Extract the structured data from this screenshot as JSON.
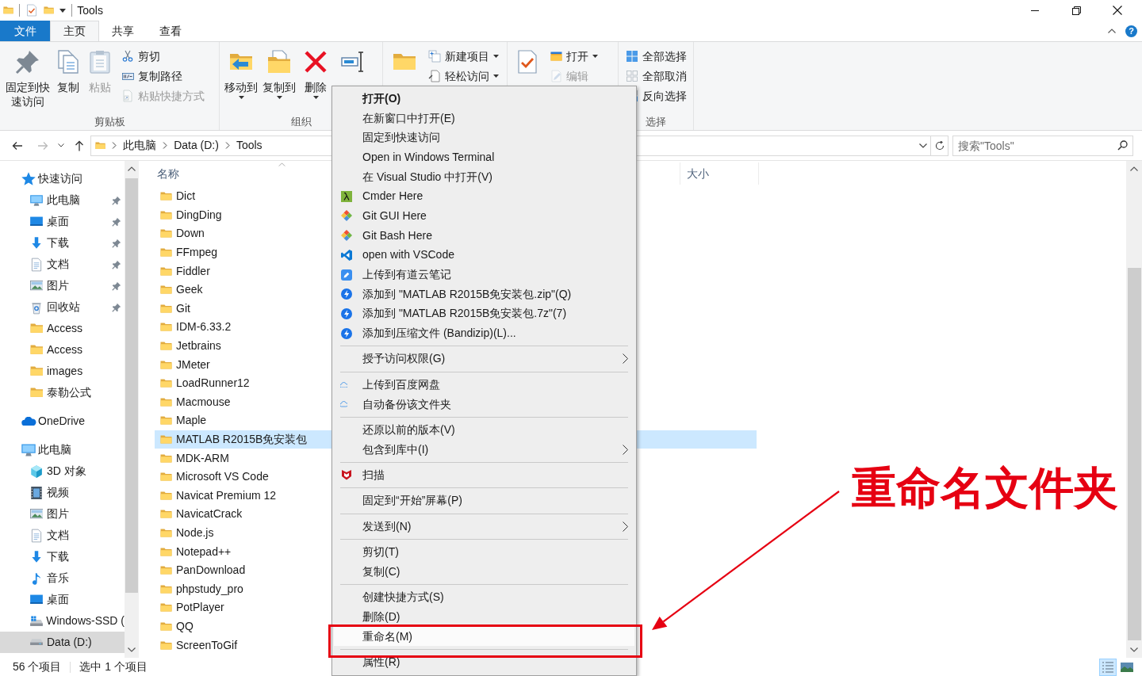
{
  "window": {
    "title": "Tools",
    "help": "?"
  },
  "ribbon": {
    "tabs": [
      {
        "label": "文件",
        "kind": "file",
        "selected": false
      },
      {
        "label": "主页",
        "kind": "tab",
        "selected": true
      },
      {
        "label": "共享",
        "kind": "tab",
        "selected": false
      },
      {
        "label": "查看",
        "kind": "tab",
        "selected": false
      }
    ],
    "groups": [
      {
        "label": "剪贴板",
        "large": [
          {
            "kind": "pin",
            "label": "固定到快速访问",
            "disabled": false,
            "dropdown": false
          },
          {
            "kind": "copy",
            "label": "复制",
            "disabled": false,
            "dropdown": false
          },
          {
            "kind": "paste",
            "label": "粘贴",
            "disabled": true,
            "dropdown": false
          }
        ],
        "small": [
          {
            "kind": "cut",
            "label": "剪切",
            "disabled": false,
            "dropdown": false
          },
          {
            "kind": "path",
            "label": "复制路径",
            "disabled": false,
            "dropdown": false
          },
          {
            "kind": "shortcut",
            "label": "粘贴快捷方式",
            "disabled": true,
            "dropdown": false
          }
        ]
      },
      {
        "label": "组织",
        "large": [
          {
            "kind": "moveto",
            "label": "移动到",
            "disabled": false,
            "dropdown": true
          },
          {
            "kind": "copyto",
            "label": "复制到",
            "disabled": false,
            "dropdown": true
          },
          {
            "kind": "delete",
            "label": "删除",
            "disabled": false,
            "dropdown": true
          },
          {
            "kind": "rename",
            "disabled": false,
            "dropdown": false
          }
        ]
      },
      {
        "large": [
          {
            "kind": "newfolder",
            "disabled": false,
            "dropdown": false
          }
        ],
        "small": [
          {
            "kind": "newitem",
            "label": "新建项目",
            "disabled": false,
            "dropdown": true
          },
          {
            "kind": "easyaccess",
            "label": "轻松访问",
            "disabled": false,
            "dropdown": true
          }
        ]
      },
      {
        "large": [
          {
            "kind": "properties",
            "disabled": false,
            "dropdown": false
          }
        ],
        "small": [
          {
            "kind": "open",
            "label": "打开",
            "disabled": false,
            "dropdown": true
          },
          {
            "kind": "edit",
            "label": "编辑",
            "disabled": true,
            "dropdown": false
          }
        ]
      },
      {
        "label": "选择",
        "small": [
          {
            "kind": "selectall",
            "label": "全部选择",
            "disabled": false,
            "dropdown": false
          },
          {
            "kind": "selectnone",
            "label": "全部取消",
            "disabled": false,
            "dropdown": false
          },
          {
            "kind": "invert",
            "label": "反向选择",
            "disabled": false,
            "dropdown": false
          }
        ]
      }
    ]
  },
  "address": {
    "path": [
      "此电脑",
      "Data (D:)",
      "Tools"
    ],
    "search_placeholder": "搜索\"Tools\""
  },
  "navigation": [
    {
      "label": "快速访问",
      "kind": "star",
      "selected": false,
      "children": [
        {
          "label": "此电脑",
          "kind": "pc",
          "pinned": true,
          "selected": false
        },
        {
          "label": "桌面",
          "kind": "desktop",
          "pinned": true,
          "selected": false
        },
        {
          "label": "下载",
          "kind": "download",
          "pinned": true,
          "selected": false
        },
        {
          "label": "文档",
          "kind": "doc",
          "pinned": true,
          "selected": false
        },
        {
          "label": "图片",
          "kind": "picture",
          "pinned": true,
          "selected": false
        },
        {
          "label": "回收站",
          "kind": "recycle",
          "pinned": true,
          "selected": false
        },
        {
          "label": "Access",
          "kind": "folder",
          "pinned": false,
          "selected": false
        },
        {
          "label": "Access",
          "kind": "folder",
          "pinned": false,
          "selected": false
        },
        {
          "label": "images",
          "kind": "folder",
          "pinned": false,
          "selected": false
        },
        {
          "label": "泰勒公式",
          "kind": "folder",
          "pinned": false,
          "selected": false
        }
      ]
    },
    {
      "label": "OneDrive",
      "kind": "onedrive",
      "selected": false
    },
    {
      "label": "此电脑",
      "kind": "pc",
      "selected": false,
      "children": [
        {
          "label": "3D 对象",
          "kind": "cube",
          "selected": false
        },
        {
          "label": "视频",
          "kind": "video",
          "selected": false
        },
        {
          "label": "图片",
          "kind": "picture",
          "selected": false
        },
        {
          "label": "文档",
          "kind": "doc",
          "selected": false
        },
        {
          "label": "下载",
          "kind": "download",
          "selected": false
        },
        {
          "label": "音乐",
          "kind": "music",
          "selected": false
        },
        {
          "label": "桌面",
          "kind": "desktop",
          "selected": false
        },
        {
          "label": "Windows-SSD (",
          "kind": "drivewin",
          "selected": false
        },
        {
          "label": "Data (D:)",
          "kind": "drive",
          "selected": true
        }
      ]
    }
  ],
  "columns": [
    {
      "label": "名称"
    },
    {
      "label": "大小"
    }
  ],
  "files": [
    {
      "name": "Dict",
      "selected": false
    },
    {
      "name": "DingDing",
      "selected": false
    },
    {
      "name": "Down",
      "selected": false
    },
    {
      "name": "FFmpeg",
      "selected": false
    },
    {
      "name": "Fiddler",
      "selected": false
    },
    {
      "name": "Geek",
      "selected": false
    },
    {
      "name": "Git",
      "selected": false
    },
    {
      "name": "IDM-6.33.2",
      "selected": false
    },
    {
      "name": "Jetbrains",
      "selected": false
    },
    {
      "name": "JMeter",
      "selected": false
    },
    {
      "name": "LoadRunner12",
      "selected": false
    },
    {
      "name": "Macmouse",
      "selected": false
    },
    {
      "name": "Maple",
      "selected": false
    },
    {
      "name": "MATLAB R2015B免安装包",
      "selected": true
    },
    {
      "name": "MDK-ARM",
      "selected": false
    },
    {
      "name": "Microsoft VS Code",
      "selected": false
    },
    {
      "name": "Navicat Premium 12",
      "selected": false
    },
    {
      "name": "NavicatCrack",
      "selected": false
    },
    {
      "name": "Node.js",
      "selected": false
    },
    {
      "name": "Notepad++",
      "selected": false
    },
    {
      "name": "PanDownload",
      "selected": false
    },
    {
      "name": "phpstudy_pro",
      "selected": false
    },
    {
      "name": "PotPlayer",
      "selected": false
    },
    {
      "name": "QQ",
      "selected": false
    },
    {
      "name": "ScreenToGif",
      "selected": false
    }
  ],
  "context_menu": [
    {
      "kind": "plain",
      "label": "打开(O)",
      "default": true,
      "submenu": false,
      "selected": false
    },
    {
      "kind": "plain",
      "label": "在新窗口中打开(E)",
      "default": false,
      "submenu": false,
      "selected": false
    },
    {
      "kind": "plain",
      "label": "固定到快速访问",
      "default": false,
      "submenu": false,
      "selected": false
    },
    {
      "kind": "plain",
      "label": "Open in Windows Terminal",
      "default": false,
      "submenu": false,
      "selected": false
    },
    {
      "kind": "plain",
      "label": "在 Visual Studio 中打开(V)",
      "default": false,
      "submenu": false,
      "selected": false
    },
    {
      "kind": "lambda",
      "label": "Cmder Here",
      "default": false,
      "submenu": false,
      "selected": false
    },
    {
      "kind": "diamond",
      "label": "Git GUI Here",
      "default": false,
      "submenu": false,
      "selected": false
    },
    {
      "kind": "diamond",
      "label": "Git Bash Here",
      "default": false,
      "submenu": false,
      "selected": false
    },
    {
      "kind": "editor",
      "label": "open with VSCode",
      "default": false,
      "submenu": false,
      "selected": false
    },
    {
      "kind": "note",
      "label": "上传到有道云笔记",
      "default": false,
      "submenu": false,
      "selected": false
    },
    {
      "kind": "archive",
      "label": "添加到 \"MATLAB R2015B免安装包.zip\"(Q)",
      "default": false,
      "submenu": false,
      "selected": false
    },
    {
      "kind": "archive",
      "label": "添加到 \"MATLAB R2015B免安装包.7z\"(7)",
      "default": false,
      "submenu": false,
      "selected": false
    },
    {
      "kind": "archive",
      "label": "添加到压缩文件 (Bandizip)(L)...",
      "default": false,
      "submenu": false,
      "selected": false
    },
    {
      "kind": "separator"
    },
    {
      "kind": "plain",
      "label": "授予访问权限(G)",
      "default": false,
      "submenu": true,
      "selected": false
    },
    {
      "kind": "separator"
    },
    {
      "kind": "cloud",
      "label": "上传到百度网盘",
      "default": false,
      "submenu": false,
      "selected": false
    },
    {
      "kind": "cloud",
      "label": "自动备份该文件夹",
      "default": false,
      "submenu": false,
      "selected": false
    },
    {
      "kind": "separator"
    },
    {
      "kind": "plain",
      "label": "还原以前的版本(V)",
      "default": false,
      "submenu": false,
      "selected": false
    },
    {
      "kind": "plain",
      "label": "包含到库中(I)",
      "default": false,
      "submenu": true,
      "selected": false
    },
    {
      "kind": "separator"
    },
    {
      "kind": "shield",
      "label": "扫描",
      "default": false,
      "submenu": false,
      "selected": false
    },
    {
      "kind": "separator"
    },
    {
      "kind": "plain",
      "label": "固定到“开始”屏幕(P)",
      "default": false,
      "submenu": false,
      "selected": false
    },
    {
      "kind": "separator"
    },
    {
      "kind": "plain",
      "label": "发送到(N)",
      "default": false,
      "submenu": true,
      "selected": false
    },
    {
      "kind": "separator"
    },
    {
      "kind": "plain",
      "label": "剪切(T)",
      "default": false,
      "submenu": false,
      "selected": false
    },
    {
      "kind": "plain",
      "label": "复制(C)",
      "default": false,
      "submenu": false,
      "selected": false
    },
    {
      "kind": "separator"
    },
    {
      "kind": "plain",
      "label": "创建快捷方式(S)",
      "default": false,
      "submenu": false,
      "selected": false
    },
    {
      "kind": "plain",
      "label": "删除(D)",
      "default": false,
      "submenu": false,
      "selected": false
    },
    {
      "kind": "plain",
      "label": "重命名(M)",
      "default": false,
      "submenu": false,
      "selected": true
    },
    {
      "kind": "separator"
    },
    {
      "kind": "plain",
      "label": "属性(R)",
      "default": false,
      "submenu": false,
      "selected": false
    }
  ],
  "status_bar": {
    "item_count": "56 个项目",
    "selection": "选中 1 个项目",
    "views": [
      {
        "kind": "details",
        "selected": true
      },
      {
        "kind": "large_icons",
        "selected": false
      }
    ]
  },
  "annotation": {
    "callout": "重命名文件夹"
  }
}
